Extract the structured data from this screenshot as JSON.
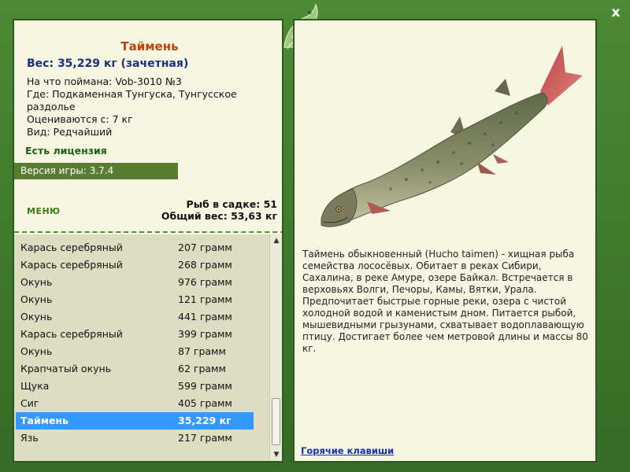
{
  "window": {
    "close_label": "x"
  },
  "fish": {
    "title": "Таймень",
    "weight_line": "Вес: 35,229 кг (зачетная)",
    "bait": "На что поймана: Vob-3010 №3",
    "location": "Где: Подкаменная Тунгуска, Тунгусское раздолье",
    "min_weight": "Оцениваются с: 7 кг",
    "kind": "Вид: Редчайший",
    "license": "Есть лицензия",
    "description": "Таймень обыкновенный (Hucho taimen) - хищная рыба семейства лососёвых. Обитает в реках Сибири, Сахалина, в реке Амуре, озере Байкал. Встречается в верховьях Волги, Печоры, Камы, Вятки, Урала. Предпочитает быстрые горные реки, озера с чистой холодной водой и каменистым дном. Питается рыбой, мышевидными грызунами, схватывает водоплавающую птицу. Достигает более чем метровой длины и массы 80 кг."
  },
  "version": "Версия игры: 3.7.4",
  "menu_label": "МЕНЮ",
  "cage": {
    "count_line": "Рыб в садке: 51",
    "total_line": "Общий вес: 53,63 кг"
  },
  "catch_list": [
    {
      "name": "Карась серебряный",
      "weight": "207 грамм"
    },
    {
      "name": "Карась серебряный",
      "weight": "268 грамм"
    },
    {
      "name": "Окунь",
      "weight": "976 грамм"
    },
    {
      "name": "Окунь",
      "weight": "121 грамм"
    },
    {
      "name": "Окунь",
      "weight": "441 грамм"
    },
    {
      "name": "Карась серебряный",
      "weight": "399 грамм"
    },
    {
      "name": "Окунь",
      "weight": "87 грамм"
    },
    {
      "name": "Крапчатый окунь",
      "weight": "62 грамм"
    },
    {
      "name": "Щука",
      "weight": "599 грамм"
    },
    {
      "name": "Сиг",
      "weight": "405 грамм"
    },
    {
      "name": "Таймень",
      "weight": "35,229 кг"
    },
    {
      "name": "Язь",
      "weight": "217 грамм"
    }
  ],
  "selected_index": 10,
  "hotkeys_label": "Горячие клавиши",
  "icons": {
    "close": "close-icon",
    "logo": "dolphin-logo-icon",
    "scroll_up": "scroll-up-arrow-icon",
    "scroll_down": "scroll-down-arrow-icon"
  },
  "colors": {
    "frame_green": "#3f7a2e",
    "panel_bg": "#f7f6e2",
    "title_orange": "#c0430e",
    "weight_blue": "#1b2f7a",
    "selection_blue": "#3399ff",
    "link_blue": "#1a2fa8"
  }
}
